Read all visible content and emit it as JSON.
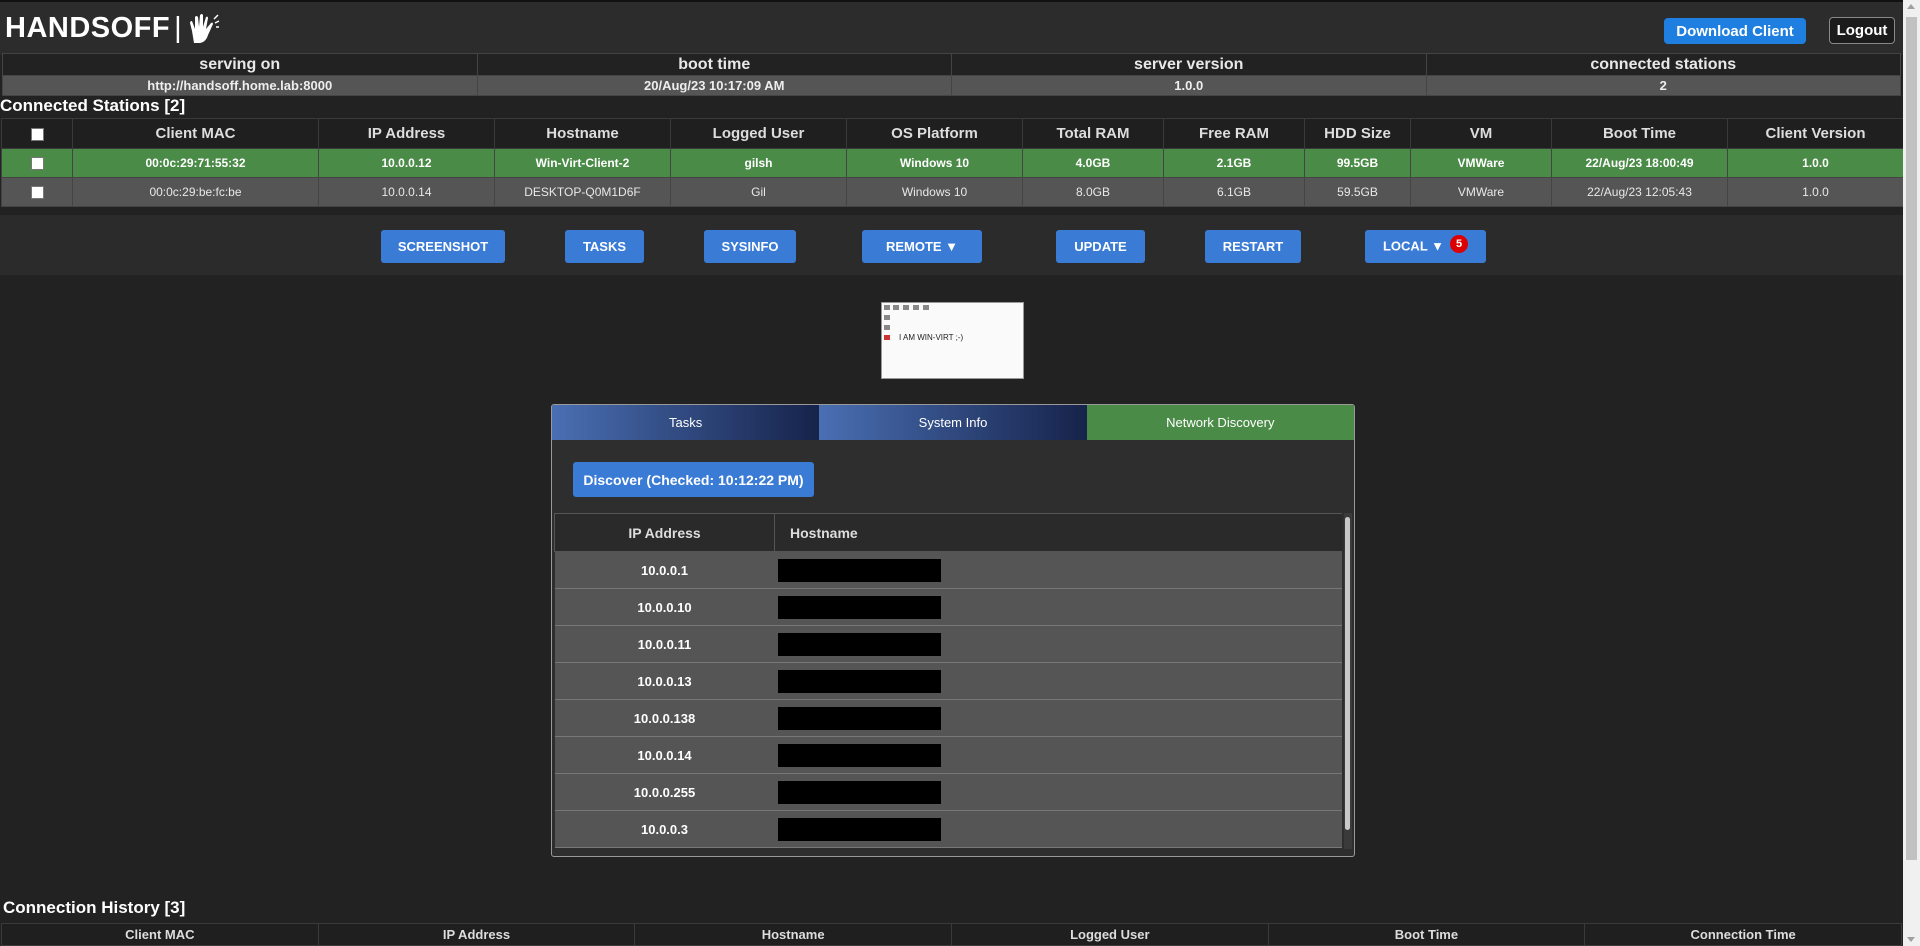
{
  "app": {
    "brand": "HANDSOFF",
    "brand_sep": "|",
    "download_label": "Download Client",
    "logout_label": "Logout"
  },
  "server_info": {
    "headers": [
      "serving on",
      "boot time",
      "server version",
      "connected stations"
    ],
    "values": [
      "http://handsoff.home.lab:8000",
      "20/Aug/23 10:17:09 AM",
      "1.0.0",
      "2"
    ]
  },
  "stations": {
    "title": "Connected Stations [2]",
    "columns": [
      "Client MAC",
      "IP Address",
      "Hostname",
      "Logged User",
      "OS Platform",
      "Total RAM",
      "Free RAM",
      "HDD Size",
      "VM",
      "Boot Time",
      "Client Version"
    ],
    "rows": [
      [
        "00:0c:29:71:55:32",
        "10.0.0.12",
        "Win-Virt-Client-2",
        "gilsh",
        "Windows 10",
        "4.0GB",
        "2.1GB",
        "99.5GB",
        "VMWare",
        "22/Aug/23 18:00:49",
        "1.0.0"
      ],
      [
        "00:0c:29:be:fc:be",
        "10.0.0.14",
        "DESKTOP-Q0M1D6F",
        "Gil",
        "Windows 10",
        "8.0GB",
        "6.1GB",
        "59.5GB",
        "VMWare",
        "22/Aug/23 12:05:43",
        "1.0.0"
      ]
    ]
  },
  "actions": {
    "screenshot": "SCREENSHOT",
    "tasks": "TASKS",
    "sysinfo": "SYSINFO",
    "remote": "REMOTE ▼",
    "update": "UPDATE",
    "restart": "RESTART",
    "local": "LOCAL ▼",
    "local_badge": "5"
  },
  "thumbnail": {
    "text": "I AM WIN-VIRT ;-)"
  },
  "panel": {
    "tabs": [
      "Tasks",
      "System Info",
      "Network Discovery"
    ],
    "active_tab": "Network Discovery",
    "discover_label": "Discover (Checked: 10:12:22 PM)",
    "columns": [
      "IP Address",
      "Hostname"
    ],
    "rows": [
      "10.0.0.1",
      "10.0.0.10",
      "10.0.0.11",
      "10.0.0.13",
      "10.0.0.138",
      "10.0.0.14",
      "10.0.0.255",
      "10.0.0.3"
    ]
  },
  "history": {
    "title": "Connection History [3]",
    "columns": [
      "Client MAC",
      "IP Address",
      "Hostname",
      "Logged User",
      "Boot Time",
      "Connection Time"
    ]
  },
  "colors": {
    "background": "#222222",
    "selected_row": "#4a8b47",
    "button_blue": "#3a7bd5",
    "download_blue": "#1e7fe0",
    "badge_red": "#dd0000"
  }
}
